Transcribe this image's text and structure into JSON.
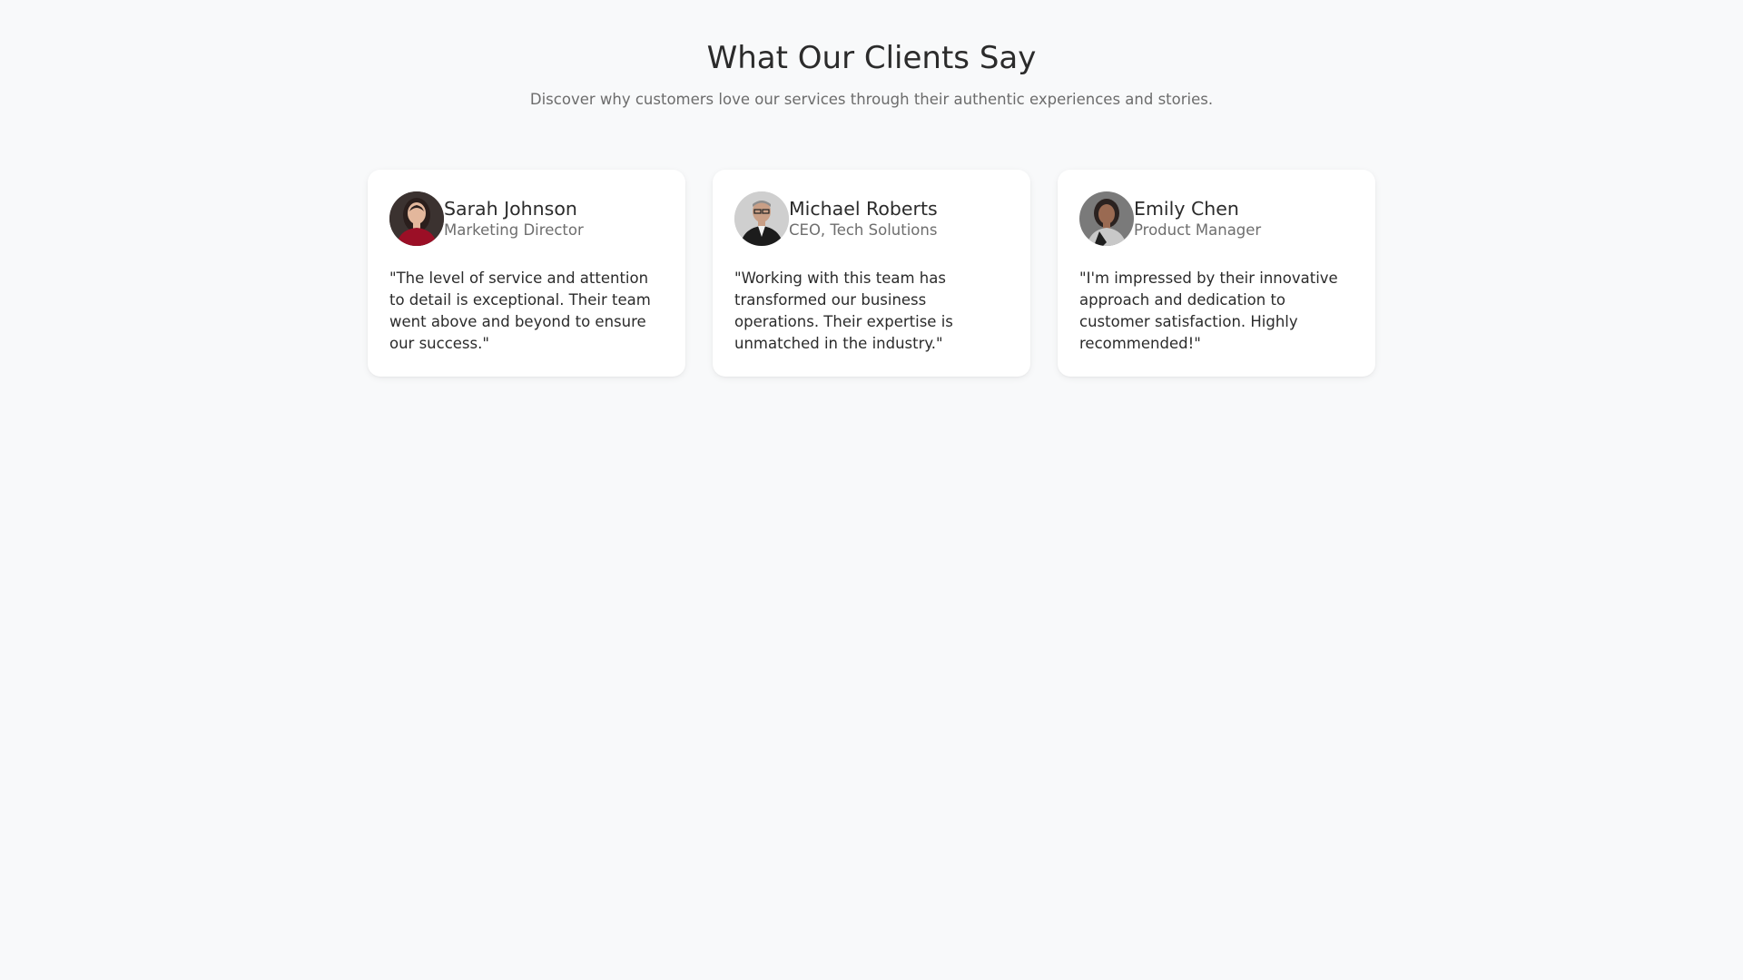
{
  "section": {
    "title": "What Our Clients Say",
    "subtitle": "Discover why customers love our services through their authentic experiences and stories."
  },
  "testimonials": [
    {
      "name": "Sarah Johnson",
      "role": "Marketing Director",
      "quote": "\"The level of service and attention to detail is exceptional. Their team went above and beyond to ensure our success.\""
    },
    {
      "name": "Michael Roberts",
      "role": "CEO, Tech Solutions",
      "quote": "\"Working with this team has transformed our business operations. Their expertise is unmatched in the industry.\""
    },
    {
      "name": "Emily Chen",
      "role": "Product Manager",
      "quote": "\"I'm impressed by their innovative approach and dedication to customer satisfaction. Highly recommended!\""
    }
  ]
}
